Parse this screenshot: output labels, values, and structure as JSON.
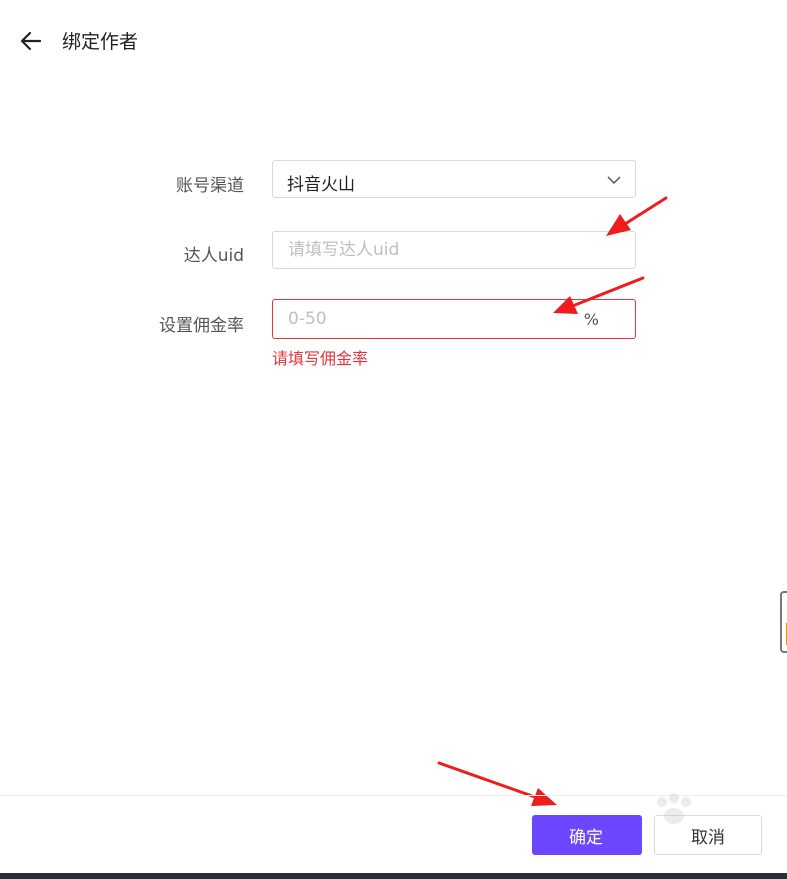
{
  "header": {
    "title": "绑定作者",
    "back_icon": "arrow-left-icon"
  },
  "form": {
    "channel": {
      "label": "账号渠道",
      "value": "抖音火山",
      "icon": "chevron-down-icon"
    },
    "uid": {
      "label": "达人uid",
      "placeholder": "请填写达人uid",
      "value": ""
    },
    "commission": {
      "label": "设置佣金率",
      "placeholder": "0-50",
      "value": "",
      "suffix": "%",
      "error": "请填写佣金率"
    }
  },
  "footer": {
    "confirm_label": "确定",
    "cancel_label": "取消"
  },
  "colors": {
    "accent": "#6c47ff",
    "error": "#e5343e",
    "annotation_arrow": "#ee1c1c"
  }
}
